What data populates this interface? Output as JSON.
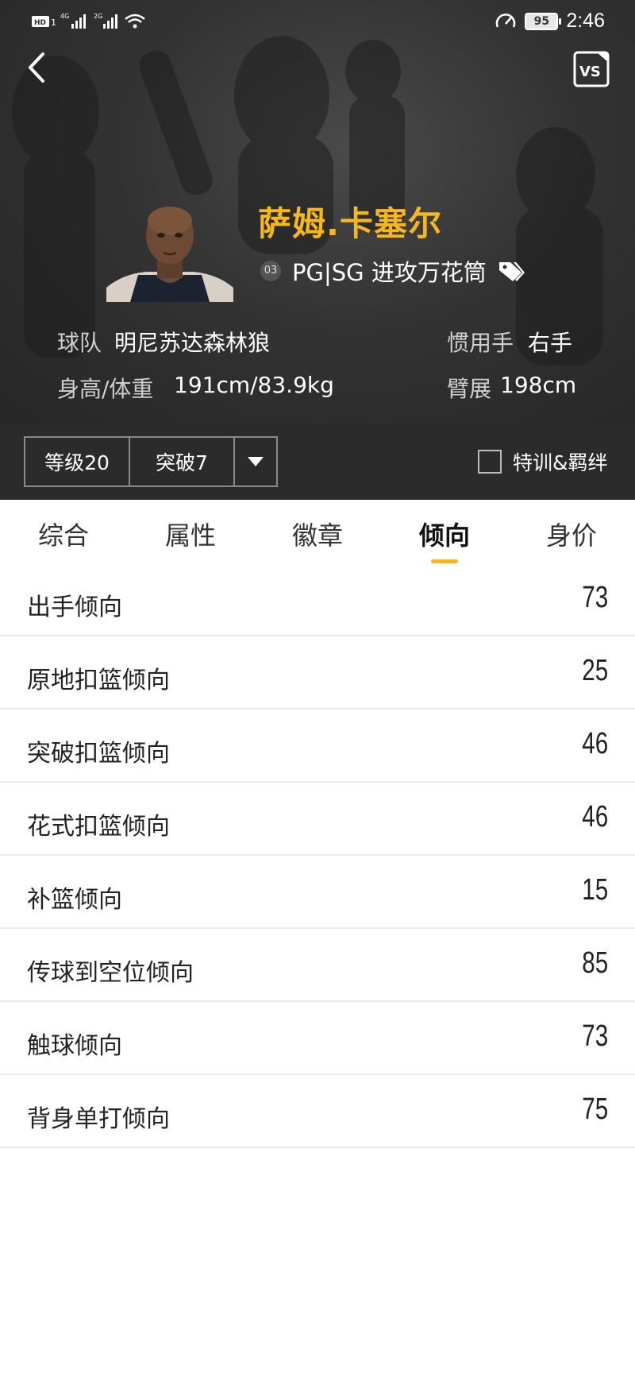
{
  "status_bar": {
    "left": "HD 1 4G 26",
    "battery": "95",
    "time": "2:46"
  },
  "header": {
    "back_icon": "chevron-left-icon",
    "vs_label": "VS"
  },
  "player": {
    "name": "萨姆.卡塞尔",
    "jersey": "03",
    "position": "PG|SG 进攻万花筒",
    "team_label": "球队",
    "team_value": "明尼苏达森林狼",
    "hand_label": "惯用手",
    "hand_value": "右手",
    "body_label": "身高/体重",
    "body_value": "191cm/83.9kg",
    "wingspan_label": "臂展",
    "wingspan_value": "198cm"
  },
  "controls": {
    "level": "等级20",
    "breakthrough": "突破7",
    "training_label": "特训&羁绊",
    "training_checked": false
  },
  "tabs": [
    {
      "label": "综合",
      "active": false
    },
    {
      "label": "属性",
      "active": false
    },
    {
      "label": "徽章",
      "active": false
    },
    {
      "label": "倾向",
      "active": true
    },
    {
      "label": "身价",
      "active": false
    }
  ],
  "tendencies": [
    {
      "label": "出手倾向",
      "value": "73"
    },
    {
      "label": "原地扣篮倾向",
      "value": "25"
    },
    {
      "label": "突破扣篮倾向",
      "value": "46"
    },
    {
      "label": "花式扣篮倾向",
      "value": "46"
    },
    {
      "label": "补篮倾向",
      "value": "15"
    },
    {
      "label": "传球到空位倾向",
      "value": "85"
    },
    {
      "label": "触球倾向",
      "value": "73"
    },
    {
      "label": "背身单打倾向",
      "value": "75"
    }
  ],
  "colors": {
    "accent": "#f6b81c",
    "header_bg": "#333333",
    "control_bg": "#2b2b2b"
  }
}
